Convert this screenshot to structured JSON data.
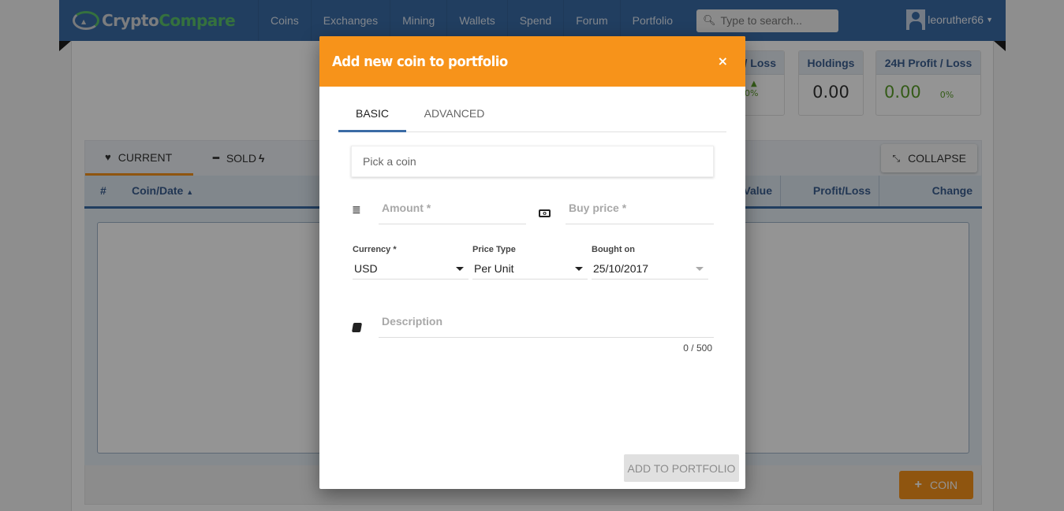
{
  "navbar": {
    "logo_part1": "Crypto",
    "logo_part2": "Compare",
    "items": [
      "Coins",
      "Exchanges",
      "Mining",
      "Wallets",
      "Spend",
      "Forum",
      "Portfolio"
    ],
    "search_placeholder": "Type to search...",
    "username": "leoruther66"
  },
  "stats": {
    "profit_loss_label": "/ Loss",
    "profit_loss_pct": "0%",
    "holdings_label": "Holdings",
    "holdings_value": "0.00",
    "profit_24h_label": "24H Profit / Loss",
    "profit_24h_value": "0.00",
    "profit_24h_pct": "0%"
  },
  "portfolio_tabs": {
    "current": "CURRENT",
    "sold": "SOLD",
    "collapse": "COLLAPSE"
  },
  "table": {
    "columns": [
      "#",
      "Coin/Date",
      "Value",
      "Profit/Loss",
      "Change"
    ]
  },
  "footer": {
    "add_coin": "COIN"
  },
  "modal": {
    "title": "Add new coin to portfolio",
    "close": "×",
    "tabs": [
      "BASIC",
      "ADVANCED"
    ],
    "active_tab": "BASIC",
    "pick_coin_placeholder": "Pick a coin",
    "amount_placeholder": "Amount *",
    "buy_price_placeholder": "Buy price *",
    "currency": {
      "label": "Currency *",
      "value": "USD"
    },
    "price_type": {
      "label": "Price Type",
      "value": "Per Unit"
    },
    "bought_on": {
      "label": "Bought on",
      "value": "25/10/2017"
    },
    "description_placeholder": "Description",
    "description_counter": "0 / 500",
    "submit": "ADD TO PORTFOLIO"
  },
  "colors": {
    "accent": "#f7931a",
    "navbar": "#3a6ba5",
    "positive": "#5b9e2a"
  }
}
